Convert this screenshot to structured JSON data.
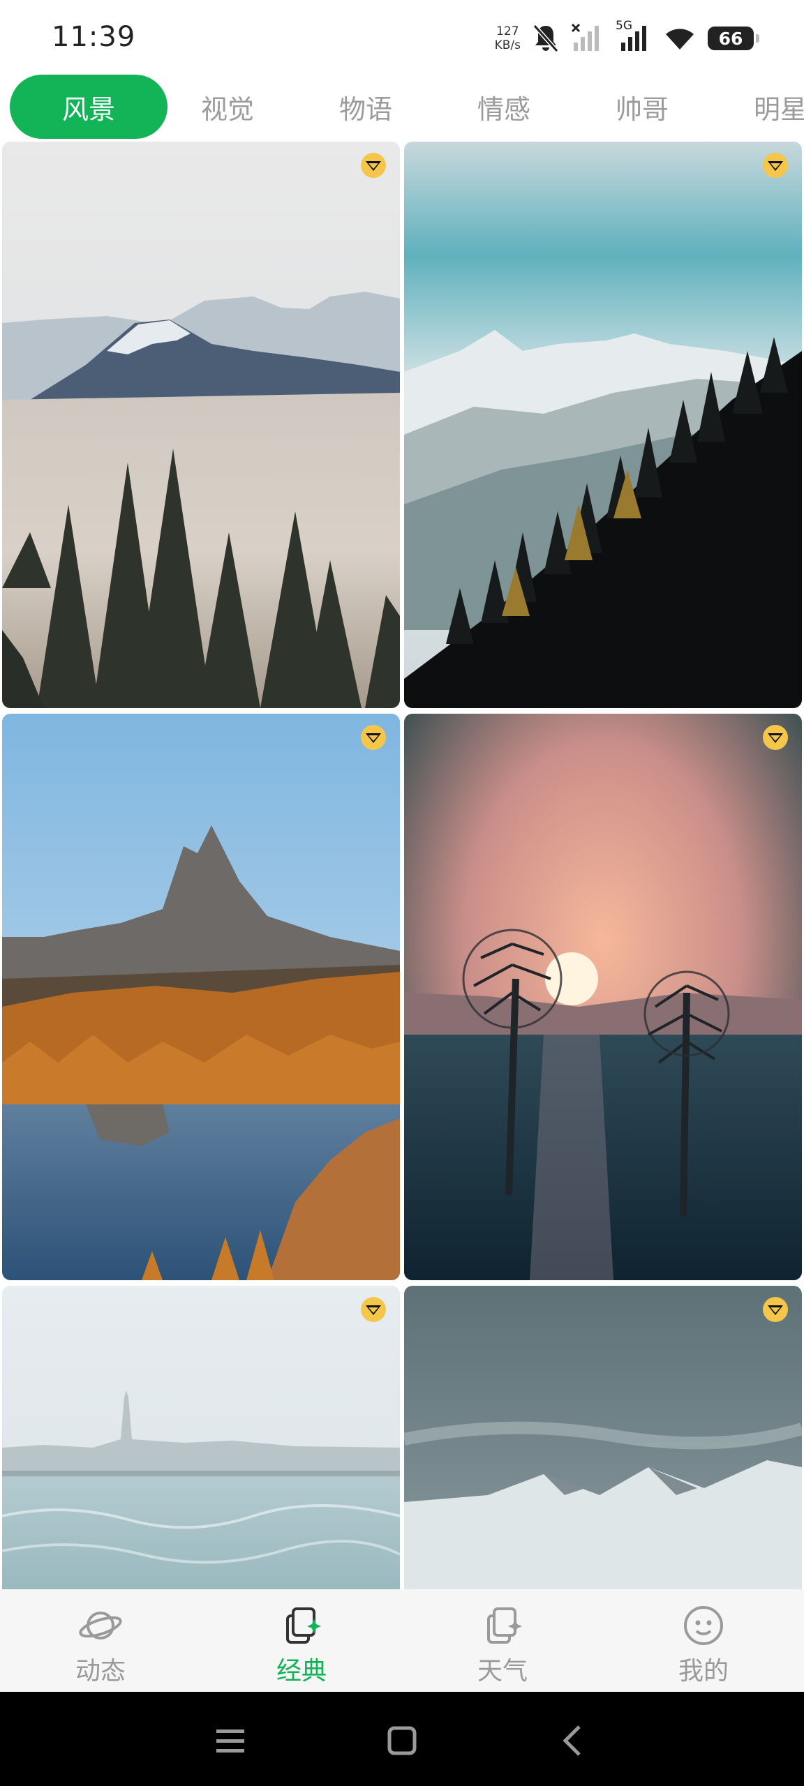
{
  "status_bar": {
    "time": "11:39",
    "net_speed_value": "127",
    "net_speed_unit": "KB/s",
    "network_type": "5G",
    "battery": "66"
  },
  "tabs": [
    {
      "label": "风景",
      "active": true
    },
    {
      "label": "视觉",
      "active": false
    },
    {
      "label": "物语",
      "active": false
    },
    {
      "label": "情感",
      "active": false
    },
    {
      "label": "帅哥",
      "active": false
    },
    {
      "label": "明星",
      "active": false
    }
  ],
  "wallpapers": [
    {
      "icon": "mountain-clouds-pines-image",
      "badge": "vip-diamond-icon"
    },
    {
      "icon": "snowy-mountain-slope-image",
      "badge": "vip-diamond-icon"
    },
    {
      "icon": "autumn-lake-peak-image",
      "badge": "vip-diamond-icon"
    },
    {
      "icon": "sunset-sea-trees-image",
      "badge": "vip-diamond-icon"
    },
    {
      "icon": "misty-coast-tower-image",
      "badge": "vip-diamond-icon"
    },
    {
      "icon": "cloudy-sky-snowpeaks-image",
      "badge": "vip-diamond-icon"
    }
  ],
  "bottom_nav": [
    {
      "label": "动态",
      "icon": "planet-icon",
      "active": false
    },
    {
      "label": "经典",
      "icon": "cards-sparkle-icon",
      "active": true
    },
    {
      "label": "天气",
      "icon": "cards-sparkle-icon",
      "active": false
    },
    {
      "label": "我的",
      "icon": "smiley-face-icon",
      "active": false
    }
  ],
  "colors": {
    "accent": "#12b457",
    "tab_inactive": "#9b9b9b",
    "nav_background": "#f6f6f6"
  }
}
